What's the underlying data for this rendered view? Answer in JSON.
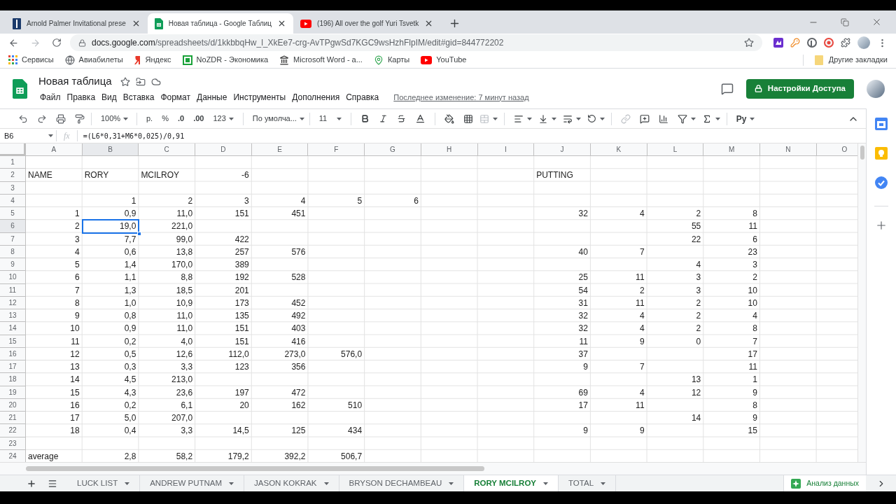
{
  "browser": {
    "tabs": [
      {
        "title": "Arnold Palmer Invitational prese",
        "selected": false
      },
      {
        "title": "Новая таблица - Google Таблиц",
        "selected": true
      },
      {
        "title": "(196) All over the golf Yuri Tsvetk",
        "selected": false
      }
    ],
    "url": {
      "host": "docs.google.com",
      "path": "/spreadsheets/d/1kkbbqHw_l_XkEe7-crg-AvTPgwSd7KGC9wsHzhFlpIM/edit#gid=844772202"
    },
    "bookmarks": [
      "Сервисы",
      "Авиабилеты",
      "Яндекс",
      "NoZDR - Экономика",
      "Microsoft Word - а...",
      "Карты",
      "YouTube"
    ],
    "other_bookmarks": "Другие закладки"
  },
  "document": {
    "title": "Новая таблица",
    "menu": [
      "Файл",
      "Правка",
      "Вид",
      "Вставка",
      "Формат",
      "Данные",
      "Инструменты",
      "Дополнения",
      "Справка"
    ],
    "last_edit": "Последнее изменение: 7 минут назад",
    "share_button": "Настройки Доступа"
  },
  "toolbar": {
    "zoom": "100%",
    "currency": "р.",
    "percent": "%",
    "decrease_decimals": ".0",
    "increase_decimals": ".00",
    "more_formats": "123",
    "font": "По умолча...",
    "font_size": "11",
    "input_tools": "Pу"
  },
  "formula_bar": {
    "cell": "B6",
    "function_label": "fx",
    "formula": "=(L6*0,31+M6*0,025)/0,91"
  },
  "sheet": {
    "columns": [
      {
        "label": "A",
        "selected": false
      },
      {
        "label": "B",
        "selected": true
      },
      {
        "label": "C",
        "selected": false
      },
      {
        "label": "D",
        "selected": false
      },
      {
        "label": "E",
        "selected": false
      },
      {
        "label": "F",
        "selected": false
      },
      {
        "label": "G",
        "selected": false
      },
      {
        "label": "H",
        "selected": false
      },
      {
        "label": "I",
        "selected": false
      },
      {
        "label": "J",
        "selected": false
      },
      {
        "label": "K",
        "selected": false
      },
      {
        "label": "L",
        "selected": false
      },
      {
        "label": "M",
        "selected": false
      },
      {
        "label": "N",
        "selected": false
      },
      {
        "label": "O",
        "selected": false
      }
    ],
    "rows": [
      {
        "number": "1",
        "selected": false
      },
      {
        "number": "2",
        "selected": false,
        "cells": [
          {
            "text": "NAME",
            "kind": "label"
          },
          {
            "text": "RORY",
            "kind": "label"
          },
          {
            "text": "MCILROY",
            "kind": "label"
          },
          "-6",
          null,
          null,
          null,
          null,
          null,
          {
            "text": "PUTTING",
            "kind": "label"
          }
        ]
      },
      {
        "number": "3",
        "selected": false
      },
      {
        "number": "4",
        "selected": false,
        "cells": [
          null,
          "1",
          "2",
          "3",
          "4",
          "5",
          "6"
        ]
      },
      {
        "number": "5",
        "selected": false,
        "cells": [
          "1",
          "0,9",
          "11,0",
          "151",
          "451",
          null,
          null,
          null,
          null,
          "32",
          "4",
          "2",
          "8"
        ]
      },
      {
        "number": "6",
        "selected": true,
        "cells": [
          "2",
          "19,0",
          "221,0",
          null,
          null,
          null,
          null,
          null,
          null,
          null,
          null,
          "55",
          "11"
        ]
      },
      {
        "number": "7",
        "selected": false,
        "cells": [
          "3",
          "7,7",
          "99,0",
          "422",
          null,
          null,
          null,
          null,
          null,
          null,
          null,
          "22",
          "6"
        ]
      },
      {
        "number": "8",
        "selected": false,
        "cells": [
          "4",
          "0,6",
          "13,8",
          "257",
          "576",
          null,
          null,
          null,
          null,
          "40",
          "7",
          null,
          "23"
        ]
      },
      {
        "number": "9",
        "selected": false,
        "cells": [
          "5",
          "1,4",
          "170,0",
          "389",
          null,
          null,
          null,
          null,
          null,
          null,
          null,
          "4",
          "3"
        ]
      },
      {
        "number": "10",
        "selected": false,
        "cells": [
          "6",
          "1,1",
          "8,8",
          "192",
          "528",
          null,
          null,
          null,
          null,
          "25",
          "11",
          "3",
          "2"
        ]
      },
      {
        "number": "11",
        "selected": false,
        "cells": [
          "7",
          "1,3",
          "18,5",
          "201",
          null,
          null,
          null,
          null,
          null,
          "54",
          "2",
          "3",
          "10"
        ]
      },
      {
        "number": "12",
        "selected": false,
        "cells": [
          "8",
          "1,0",
          "10,9",
          "173",
          "452",
          null,
          null,
          null,
          null,
          "31",
          "11",
          "2",
          "10"
        ]
      },
      {
        "number": "13",
        "selected": false,
        "cells": [
          "9",
          "0,8",
          "11,0",
          "135",
          "492",
          null,
          null,
          null,
          null,
          "32",
          "4",
          "2",
          "4"
        ]
      },
      {
        "number": "14",
        "selected": false,
        "cells": [
          "10",
          "0,9",
          "11,0",
          "151",
          "403",
          null,
          null,
          null,
          null,
          "32",
          "4",
          "2",
          "8"
        ]
      },
      {
        "number": "15",
        "selected": false,
        "cells": [
          "11",
          "0,2",
          "4,0",
          "151",
          "416",
          null,
          null,
          null,
          null,
          "11",
          "9",
          "0",
          "7"
        ]
      },
      {
        "number": "16",
        "selected": false,
        "cells": [
          "12",
          "0,5",
          "12,6",
          "112,0",
          "273,0",
          "576,0",
          null,
          null,
          null,
          "37",
          null,
          null,
          "17"
        ]
      },
      {
        "number": "17",
        "selected": false,
        "cells": [
          "13",
          "0,3",
          "3,3",
          "123",
          "356",
          null,
          null,
          null,
          null,
          "9",
          "7",
          null,
          "11"
        ]
      },
      {
        "number": "18",
        "selected": false,
        "cells": [
          "14",
          "4,5",
          "213,0",
          null,
          null,
          null,
          null,
          null,
          null,
          null,
          null,
          "13",
          "1"
        ]
      },
      {
        "number": "19",
        "selected": false,
        "cells": [
          "15",
          "4,3",
          "23,6",
          "197",
          "472",
          null,
          null,
          null,
          null,
          "69",
          "4",
          "12",
          "9"
        ]
      },
      {
        "number": "20",
        "selected": false,
        "cells": [
          "16",
          "0,2",
          "6,1",
          "20",
          "162",
          "510",
          null,
          null,
          null,
          "17",
          "11",
          null,
          "8"
        ]
      },
      {
        "number": "21",
        "selected": false,
        "cells": [
          "17",
          "5,0",
          "207,0",
          null,
          null,
          null,
          null,
          null,
          null,
          null,
          null,
          "14",
          "9"
        ]
      },
      {
        "number": "22",
        "selected": false,
        "cells": [
          "18",
          "0,4",
          "3,3",
          "14,5",
          "125",
          "434",
          null,
          null,
          null,
          "9",
          "9",
          null,
          "15"
        ]
      },
      {
        "number": "23",
        "selected": false
      },
      {
        "number": "24",
        "selected": false,
        "cells": [
          {
            "text": "average",
            "kind": "label"
          },
          "2,8",
          "58,2",
          "179,2",
          "392,2",
          "506,7"
        ]
      }
    ]
  },
  "sheet_tabs": [
    {
      "label": "LUCK LIST",
      "selected": false
    },
    {
      "label": "ANDREW PUTNAM",
      "selected": false
    },
    {
      "label": "JASON KOKRAK",
      "selected": false
    },
    {
      "label": "BRYSON DECHAMBEAU",
      "selected": false
    },
    {
      "label": "RORY MCILROY",
      "selected": true
    },
    {
      "label": "TOTAL",
      "selected": false
    }
  ],
  "explore_button": "Анализ данных"
}
